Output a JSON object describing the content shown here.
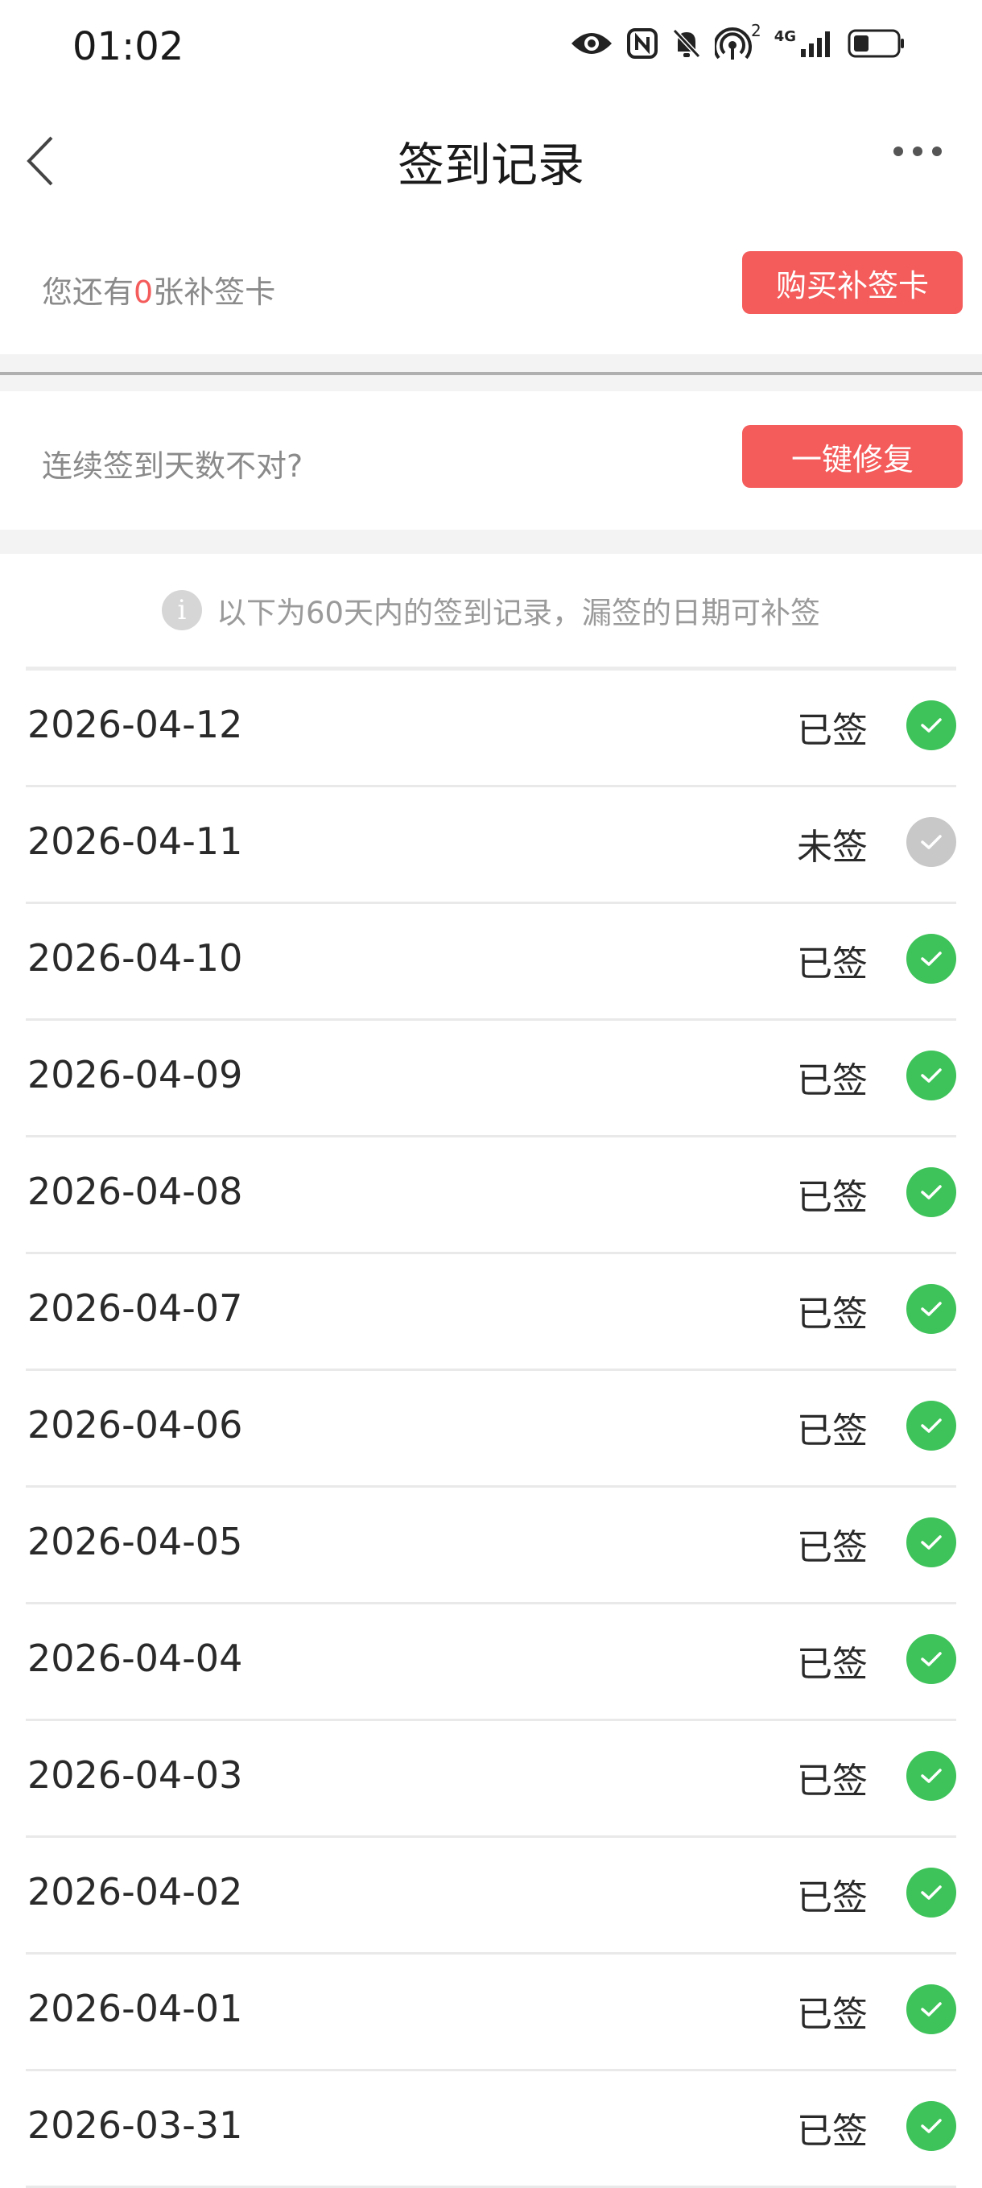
{
  "status_bar": {
    "time": "01:02",
    "icons": [
      "eye-icon",
      "nfc-icon",
      "bell-off-icon",
      "hotspot-icon",
      "signal-4g-icon",
      "battery-icon"
    ],
    "hotspot_count": "2",
    "network": "4G"
  },
  "nav": {
    "title": "签到记录"
  },
  "card": {
    "prefix": "您还有",
    "count": "0",
    "suffix": "张补签卡",
    "buy_label": "购买补签卡"
  },
  "repair": {
    "label": "连续签到天数不对?",
    "button_label": "一键修复"
  },
  "notice": {
    "icon": "i",
    "text": "以下为60天内的签到记录，漏签的日期可补签"
  },
  "colors": {
    "accent_red": "#f45b5b",
    "checked_green": "#3ec35a",
    "unchecked_gray": "#c8c8c8"
  },
  "records": [
    {
      "date": "2026-04-12",
      "status": "已签",
      "checked": true
    },
    {
      "date": "2026-04-11",
      "status": "未签",
      "checked": false
    },
    {
      "date": "2026-04-10",
      "status": "已签",
      "checked": true
    },
    {
      "date": "2026-04-09",
      "status": "已签",
      "checked": true
    },
    {
      "date": "2026-04-08",
      "status": "已签",
      "checked": true
    },
    {
      "date": "2026-04-07",
      "status": "已签",
      "checked": true
    },
    {
      "date": "2026-04-06",
      "status": "已签",
      "checked": true
    },
    {
      "date": "2026-04-05",
      "status": "已签",
      "checked": true
    },
    {
      "date": "2026-04-04",
      "status": "已签",
      "checked": true
    },
    {
      "date": "2026-04-03",
      "status": "已签",
      "checked": true
    },
    {
      "date": "2026-04-02",
      "status": "已签",
      "checked": true
    },
    {
      "date": "2026-04-01",
      "status": "已签",
      "checked": true
    },
    {
      "date": "2026-03-31",
      "status": "已签",
      "checked": true
    }
  ]
}
